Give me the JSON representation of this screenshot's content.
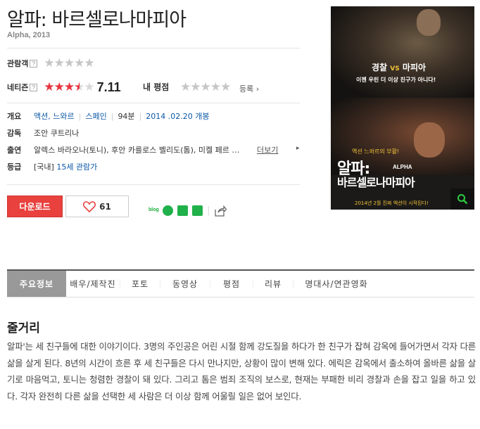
{
  "movie": {
    "title": "알파: 바르셀로나마피아",
    "subtitle": "Alpha, 2013"
  },
  "ratings": {
    "audience_label": "관람객",
    "audience_help": "?",
    "netizen_label": "네티즌",
    "netizen_help": "?",
    "netizen_score": "7.11",
    "netizen_fraction": 0.711,
    "mine_label": "내 평점",
    "register_label": "등록 ›",
    "star_glyphs": "★★★★★",
    "accent": "#e8343f"
  },
  "info": {
    "genre_label": "개요",
    "genres": [
      "액션",
      "느와르"
    ],
    "genre_sep": ",",
    "country": "스페인",
    "runtime": "94분",
    "release": "2014 .02.20 개봉",
    "director_label": "감독",
    "director": "조안 쿠트리나",
    "cast_label": "출연",
    "cast": "알렉스 바라오나(토니), 후안 카를로스 벨리도(톰), 미켈 페르 …",
    "more_label": "더보기",
    "more_arrow": "▸",
    "rating_label": "등급",
    "rating_tag": "[국내]",
    "rating_value": "15세 관람가"
  },
  "actions": {
    "download_label": "다운로드",
    "like_count": "61",
    "share_blog": "blog"
  },
  "poster": {
    "tag_line_1a": "경찰",
    "tag_line_1vs": "VS",
    "tag_line_1b": "마피아",
    "tag_line_2": "이젠 우린 더 이상 친구가 아니다!",
    "tag_line_3": "액션 느와르의 부활!",
    "title_big": "알파:",
    "title_alpha": "ALPHA",
    "title_small": "바르셀로나마피아",
    "bottom_line": "2014년 2월 진짜 액션이 시작된다!"
  },
  "tabs": [
    {
      "label": "주요정보",
      "active": true
    },
    {
      "label": "배우/제작진",
      "active": false
    },
    {
      "label": "포토",
      "active": false
    },
    {
      "label": "동영상",
      "active": false
    },
    {
      "label": "평점",
      "active": false
    },
    {
      "label": "리뷰",
      "active": false
    },
    {
      "label": "명대사/연관영화",
      "active": false
    }
  ],
  "synopsis": {
    "heading": "줄거리",
    "text": "알파'는 세 친구들에 대한 이야기이다. 3명의 주인공은 어린 시절 함께 강도질을 하다가 한 친구가 잡혀 감옥에 들어가면서 각자 다른 삶을 살게 된다. 8년의 시간이 흐른 후 세 친구들은 다시 만나지만, 상황이 많이 변해 있다. 에릭은 감옥에서 출소하여 올바른 삶을 살기로 마음먹고, 토니는 청렴한 경찰이 돼 있다. 그리고 톰은 범죄 조직의 보스로, 현재는 부패한 비리 경찰과 손을 잡고 일을 하고 있다. 각자 완전히 다른 삶을 선택한 세 사람은 더 이상 함께 어울릴 일은 없어 보인다."
  }
}
